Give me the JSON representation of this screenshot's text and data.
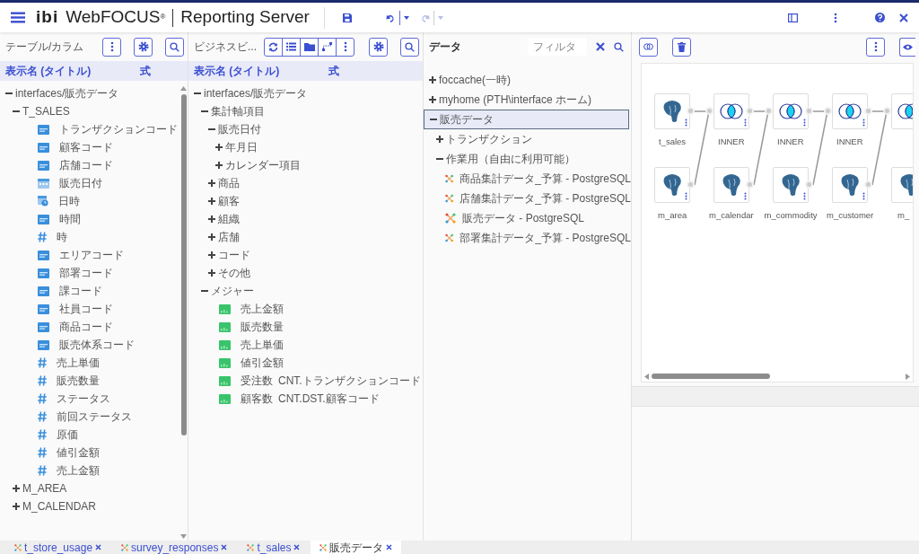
{
  "header": {
    "brand": "ibi",
    "product": "WebFOCUS$^{®}$",
    "subtitle": "Reporting Server"
  },
  "table_panel": {
    "title": "テーブル/カラム",
    "columns": [
      "表示名 (タイトル)",
      "式"
    ],
    "tree": [
      {
        "label": "interfaces/販売データ",
        "expanded": true,
        "children": [
          {
            "label": "T_SALES",
            "expanded": true,
            "children": [
              {
                "label": "トランザクションコード",
                "kind": "text"
              },
              {
                "label": "顧客コード",
                "kind": "text"
              },
              {
                "label": "店舗コード",
                "kind": "text"
              },
              {
                "label": "販売日付",
                "kind": "date"
              },
              {
                "label": "日時",
                "kind": "datetime"
              },
              {
                "label": "時間",
                "kind": "text"
              },
              {
                "label": "時",
                "kind": "number"
              },
              {
                "label": "エリアコード",
                "kind": "text"
              },
              {
                "label": "部署コード",
                "kind": "text"
              },
              {
                "label": "課コード",
                "kind": "text"
              },
              {
                "label": "社員コード",
                "kind": "text"
              },
              {
                "label": "商品コード",
                "kind": "text"
              },
              {
                "label": "販売体系コード",
                "kind": "text"
              },
              {
                "label": "売上単価",
                "kind": "number"
              },
              {
                "label": "販売数量",
                "kind": "number"
              },
              {
                "label": "ステータス",
                "kind": "number"
              },
              {
                "label": "前回ステータス",
                "kind": "number"
              },
              {
                "label": "原価",
                "kind": "number"
              },
              {
                "label": "値引金額",
                "kind": "number"
              },
              {
                "label": "売上金額",
                "kind": "number"
              }
            ]
          },
          {
            "label": "M_AREA",
            "expanded": false
          },
          {
            "label": "M_CALENDAR",
            "expanded": false
          }
        ]
      }
    ]
  },
  "business_panel": {
    "title": "ビジネスビ...",
    "columns": [
      "表示名 (タイトル)",
      "式"
    ],
    "tree": [
      {
        "label": "interfaces/販売データ",
        "expanded": true,
        "children": [
          {
            "label": "集計軸項目",
            "expanded": true,
            "children": [
              {
                "label": "販売日付",
                "expanded": true,
                "children": [
                  {
                    "label": "年月日",
                    "expanded": false
                  },
                  {
                    "label": "カレンダー項目",
                    "expanded": false
                  }
                ]
              },
              {
                "label": "商品",
                "expanded": false
              },
              {
                "label": "顧客",
                "expanded": false
              },
              {
                "label": "組織",
                "expanded": false
              },
              {
                "label": "店舗",
                "expanded": false
              },
              {
                "label": "コード",
                "expanded": false
              },
              {
                "label": "その他",
                "expanded": false
              }
            ]
          },
          {
            "label": "メジャー",
            "expanded": true,
            "children": [
              {
                "label": "売上金額",
                "kind": "measure"
              },
              {
                "label": "販売数量",
                "kind": "measure"
              },
              {
                "label": "売上単価",
                "kind": "measure"
              },
              {
                "label": "値引金額",
                "kind": "measure"
              },
              {
                "label": "受注数",
                "kind": "measure",
                "formula": "CNT.トランザクションコード"
              },
              {
                "label": "顧客数",
                "kind": "measure",
                "formula": "CNT.DST.顧客コード"
              }
            ]
          }
        ]
      }
    ]
  },
  "data_panel": {
    "title": "データ",
    "filter": {
      "placeholder": "フィルタ"
    },
    "tree": [
      {
        "label": "foccache(一時)",
        "expanded": false,
        "selected": false
      },
      {
        "label": "myhome (PTH\\interface ホーム)",
        "expanded": false,
        "selected": false
      },
      {
        "label": "販売データ",
        "expanded": true,
        "selected": true,
        "children": [
          {
            "label": "トランザクション",
            "expanded": false,
            "selected": false
          },
          {
            "label": "作業用（自由に利用可能）",
            "expanded": true,
            "selected": false,
            "children": [
              {
                "label": "商品集計データ_予算 - PostgreSQL",
                "kind": "synonym",
                "selected": false
              },
              {
                "label": "店舗集計データ_予算 - PostgreSQL",
                "kind": "synonym",
                "selected": false
              },
              {
                "label": "販売データ - PostgreSQL",
                "kind": "synonym",
                "selected": false
              },
              {
                "label": "部署集計データ_予算 - PostgreSQL",
                "kind": "synonym",
                "selected": false
              }
            ]
          }
        ]
      }
    ]
  },
  "flow": {
    "columns": [
      {
        "top": {
          "label": "t_sales",
          "kind": "source"
        },
        "bottom": {
          "label": "m_area",
          "kind": "source"
        }
      },
      {
        "top": {
          "label": "INNER",
          "kind": "join"
        },
        "bottom": {
          "label": "m_calendar",
          "kind": "source"
        }
      },
      {
        "top": {
          "label": "INNER",
          "kind": "join"
        },
        "bottom": {
          "label": "m_commodity",
          "kind": "source"
        }
      },
      {
        "top": {
          "label": "INNER",
          "kind": "join"
        },
        "bottom": {
          "label": "m_customer",
          "kind": "source"
        }
      },
      {
        "top": {
          "kind": "join"
        },
        "bottom": {
          "label": "m_",
          "kind": "source"
        }
      }
    ]
  },
  "bottom_tabs": [
    {
      "label": "t_store_usage",
      "selected": false
    },
    {
      "label": "survey_responses",
      "selected": false
    },
    {
      "label": "t_sales",
      "selected": false
    },
    {
      "label": "販売データ",
      "selected": true
    }
  ]
}
